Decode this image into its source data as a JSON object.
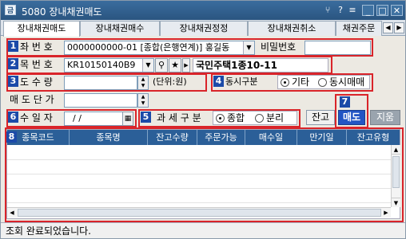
{
  "window": {
    "title": "5080 장내채권매도",
    "icon_label": "금",
    "controls": [
      "pin-icon",
      "question-icon",
      "menu-icon",
      "minimize-icon",
      "maximize-icon",
      "close-icon"
    ]
  },
  "tabs": [
    {
      "label": "장내채권매도",
      "active": true
    },
    {
      "label": "장내채권매수",
      "active": false
    },
    {
      "label": "장내채권정정",
      "active": false
    },
    {
      "label": "장내채권취소",
      "active": false
    },
    {
      "label": "채권주문",
      "active": false
    }
  ],
  "markers": [
    "1",
    "2",
    "3",
    "4",
    "5",
    "6",
    "7",
    "8"
  ],
  "form": {
    "account_label": "좌 번 호",
    "account_value": "0000000000-01 [종합(은행연계)] 홍길동",
    "password_label": "비밀번호",
    "password_value": "",
    "code_label": "목 번 호",
    "code_value": "KR10150140B9",
    "bond_name": "국민주택1종10-11",
    "qty_label": "도 수 량",
    "qty_value": "",
    "unit_label": "(단위:원)",
    "price_label": "매 도 단 가",
    "price_value": "",
    "date_label": "수 일 자",
    "date_value": "/ /",
    "tax_label": "과 세 구 분",
    "tax_options": [
      "종합",
      "분리"
    ],
    "tax_selected": "종합",
    "trade_label": "동시구분",
    "trade_options": [
      "기타",
      "동시매매"
    ],
    "trade_selected": "기타"
  },
  "buttons": {
    "balance": "잔고",
    "sell": "매도",
    "clear": "지움"
  },
  "grid": {
    "columns": [
      "종목코드",
      "종목명",
      "잔고수량",
      "주문가능",
      "매수일",
      "만기일",
      "잔고유형"
    ],
    "rows": []
  },
  "status": "조회 완료되었습니다."
}
